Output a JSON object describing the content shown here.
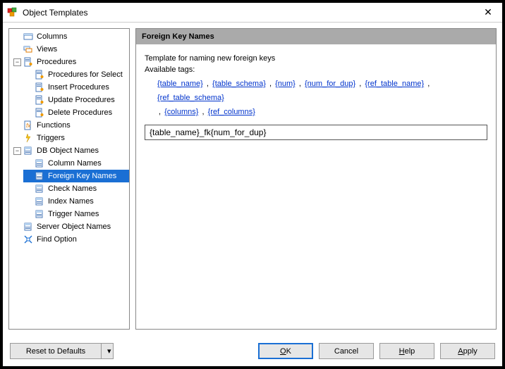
{
  "window": {
    "title": "Object Templates",
    "close_glyph": "✕"
  },
  "tree": {
    "columns": "Columns",
    "views": "Views",
    "procedures": "Procedures",
    "procedures_select": "Procedures for Select",
    "insert_proc": "Insert Procedures",
    "update_proc": "Update Procedures",
    "delete_proc": "Delete Procedures",
    "functions": "Functions",
    "triggers": "Triggers",
    "db_object_names": "DB Object Names",
    "column_names": "Column Names",
    "foreign_key_names": "Foreign Key Names",
    "check_names": "Check Names",
    "index_names": "Index Names",
    "trigger_names": "Trigger Names",
    "server_object_names": "Server Object Names",
    "find_option": "Find Option"
  },
  "detail": {
    "header": "Foreign Key Names",
    "desc": "Template for naming new foreign keys",
    "available_tags_label": "Available tags:",
    "tags": {
      "t0": "{table_name}",
      "t1": "{table_schema}",
      "t2": "{num}",
      "t3": "{num_for_dup}",
      "t4": "{ref_table_name}",
      "t5": "{ref_table_schema}",
      "t6": "{columns}",
      "t7": "{ref_columns}"
    },
    "sep": ",",
    "template_value": "{table_name}_fk{num_for_dup}"
  },
  "buttons": {
    "reset": "Reset to Defaults",
    "ok_underline": "O",
    "ok_rest": "K",
    "cancel": "Cancel",
    "help_underline": "H",
    "help_rest": "elp",
    "apply_underline": "A",
    "apply_rest": "pply",
    "drop_glyph": "▾"
  }
}
